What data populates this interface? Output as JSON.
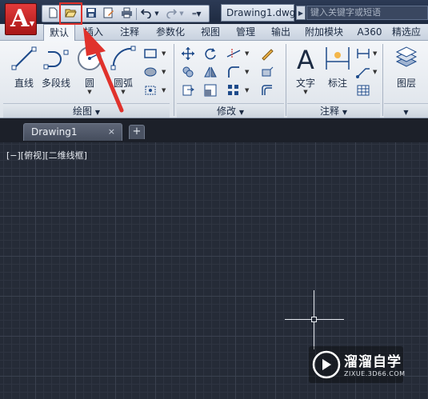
{
  "titlebar": {
    "app_logo": "A",
    "document_title": "Drawing1.dwg",
    "search_placeholder": "键入关键字或短语"
  },
  "ribbon_tabs": [
    "默认",
    "插入",
    "注释",
    "参数化",
    "视图",
    "管理",
    "输出",
    "附加模块",
    "A360",
    "精选应"
  ],
  "active_tab": "默认",
  "draw_panel": {
    "title": "绘图",
    "tools": [
      "直线",
      "多段线",
      "圆",
      "圆弧"
    ]
  },
  "modify_panel": {
    "title": "修改"
  },
  "annotation_panel": {
    "title": "注释",
    "tools": [
      "文字",
      "标注"
    ]
  },
  "layers_panel": {
    "tool": "图层"
  },
  "file_tabs": [
    {
      "name": "Drawing1",
      "close": "×"
    }
  ],
  "new_tab_label": "+",
  "viewport_label": "[−][俯视][二维线框]",
  "watermark": {
    "name": "溜溜自学",
    "url": "ZIXUE.3D66.COM"
  },
  "colors": {
    "app_button": "#c9252b",
    "highlight": "#e0322c",
    "canvas": "#252b37"
  }
}
